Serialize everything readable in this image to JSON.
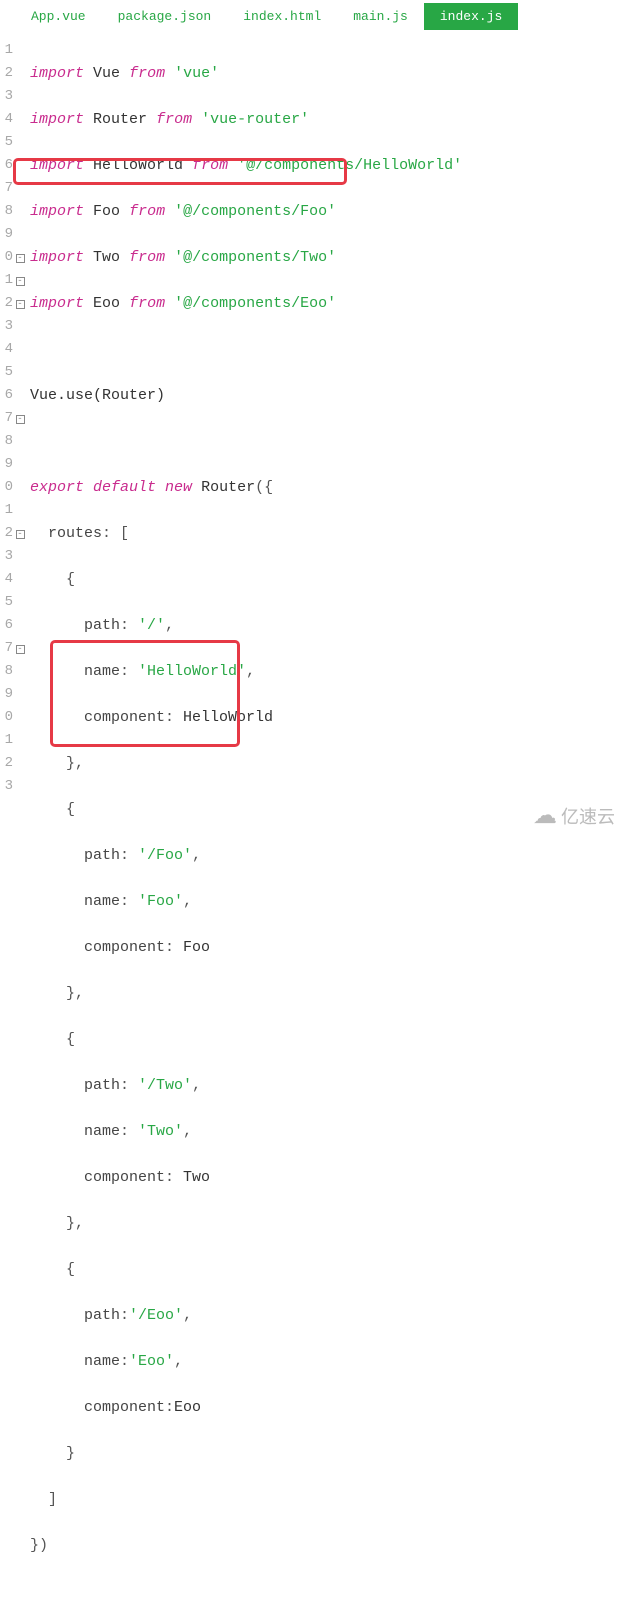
{
  "tabs": [
    {
      "label": "App.vue"
    },
    {
      "label": "package.json"
    },
    {
      "label": "index.html"
    },
    {
      "label": "main.js"
    },
    {
      "label": "index.js"
    }
  ],
  "activeTab": "index.js",
  "lines": [
    "1",
    "2",
    "3",
    "4",
    "5",
    "6",
    "7",
    "8",
    "9",
    "0",
    "1",
    "2",
    "3",
    "4",
    "5",
    "6",
    "7",
    "8",
    "9",
    "0",
    "1",
    "2",
    "3",
    "4",
    "5",
    "6",
    "7",
    "8",
    "9",
    "0",
    "1",
    "2",
    "3"
  ],
  "code": {
    "l1": {
      "kw": "import",
      "id": "Vue",
      "kw2": "from",
      "str": "'vue'"
    },
    "l2": {
      "kw": "import",
      "id": "Router",
      "kw2": "from",
      "str": "'vue-router'"
    },
    "l3": {
      "kw": "import",
      "id": "HelloWorld",
      "kw2": "from",
      "str": "'@/components/HelloWorld'"
    },
    "l4": {
      "kw": "import",
      "id": "Foo",
      "kw2": "from",
      "str": "'@/components/Foo'"
    },
    "l5": {
      "kw": "import",
      "id": "Two",
      "kw2": "from",
      "str": "'@/components/Two'"
    },
    "l6": {
      "kw": "import",
      "id": "Eoo",
      "kw2": "from",
      "str": "'@/components/Eoo'"
    },
    "l8": {
      "txt": "Vue.use(Router)"
    },
    "l10": {
      "kw": "export default",
      "kw2": "new",
      "id": "Router",
      "open": "({"
    },
    "l11": {
      "key": "routes",
      "colon": ": [",
      "open": ""
    },
    "l12": {
      "open": "{"
    },
    "l13": {
      "key": "path",
      "colon": ": ",
      "val": "'/'",
      "comma": ","
    },
    "l14": {
      "key": "name",
      "colon": ": ",
      "val": "'HelloWorld'",
      "comma": ","
    },
    "l15": {
      "key": "component",
      "colon": ": ",
      "id": "HelloWorld"
    },
    "l16": {
      "close": "},"
    },
    "l17": {
      "open": "{"
    },
    "l18": {
      "key": "path",
      "colon": ": ",
      "val": "'/Foo'",
      "comma": ","
    },
    "l19": {
      "key": "name",
      "colon": ": ",
      "val": "'Foo'",
      "comma": ","
    },
    "l20": {
      "key": "component",
      "colon": ": ",
      "id": "Foo"
    },
    "l21": {
      "close": "},"
    },
    "l22": {
      "open": "{"
    },
    "l23": {
      "key": "path",
      "colon": ": ",
      "val": "'/Two'",
      "comma": ","
    },
    "l24": {
      "key": "name",
      "colon": ": ",
      "val": "'Two'",
      "comma": ","
    },
    "l25": {
      "key": "component",
      "colon": ": ",
      "id": "Two"
    },
    "l26": {
      "close": "},"
    },
    "l27": {
      "open": "{"
    },
    "l28": {
      "key": "path",
      "colon": ":",
      "val": "'/Eoo'",
      "comma": ","
    },
    "l29": {
      "key": "name",
      "colon": ":",
      "val": "'Eoo'",
      "comma": ","
    },
    "l30": {
      "key": "component",
      "colon": ":",
      "id": "Eoo"
    },
    "l31": {
      "close": "}"
    },
    "l32": {
      "close": "]"
    },
    "l33": {
      "close": "})"
    }
  },
  "watermark": "亿速云"
}
